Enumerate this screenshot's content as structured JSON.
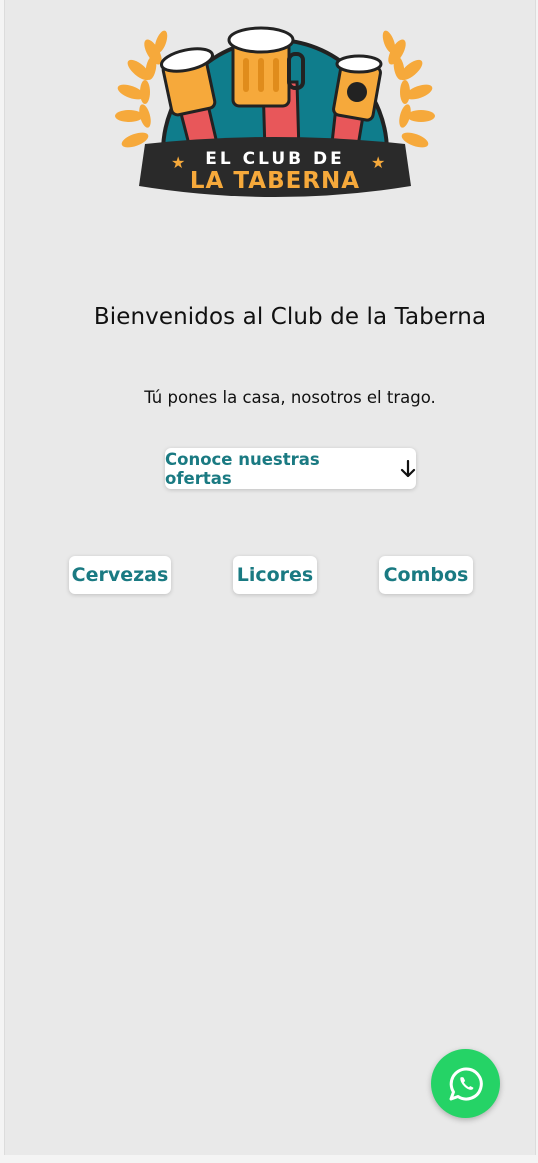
{
  "logo": {
    "line1": "EL CLUB DE",
    "line2": "LA TABERNA"
  },
  "hero": {
    "title": "Bienvenidos al Club de la Taberna",
    "subtitle": "Tú pones la casa, nosotros el trago."
  },
  "offers_button": {
    "label": "Conoce nuestras ofertas",
    "icon": "arrow-down-icon"
  },
  "categories": [
    {
      "label": "Cervezas"
    },
    {
      "label": "Licores"
    },
    {
      "label": "Combos"
    }
  ],
  "whatsapp": {
    "icon": "whatsapp-icon",
    "color": "#25d366"
  },
  "colors": {
    "accent": "#1a7a82",
    "background": "#e9e9e9",
    "logo_orange": "#f6a93b",
    "logo_teal": "#0f7d8c",
    "logo_dark": "#2a2a2a"
  }
}
